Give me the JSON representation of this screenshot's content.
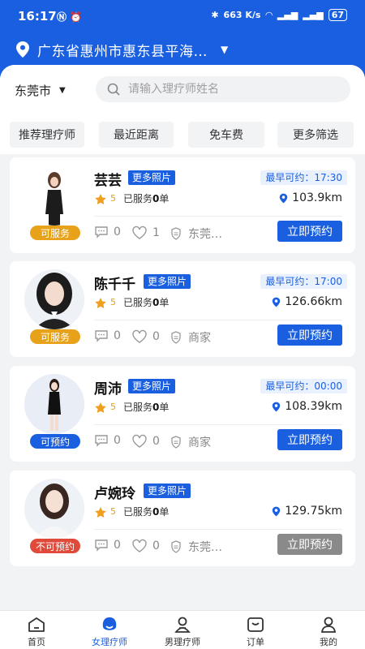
{
  "status_bar": {
    "time": "16:17",
    "net_speed": "663 K/s",
    "battery": "67"
  },
  "location": {
    "text": "广东省惠州市惠东县平海…"
  },
  "search": {
    "city": "东莞市",
    "placeholder": "请输入理疗师姓名"
  },
  "filters": [
    "推荐理疗师",
    "最近距离",
    "免车费",
    "更多筛选"
  ],
  "more_photos_label": "更多照片",
  "book_label": "立即预约",
  "served_prefix": "已服务",
  "served_suffix": "单",
  "therapists": [
    {
      "name": "芸芸",
      "status": "可服务",
      "status_color": "#e8a21a",
      "earliest": "最早可约：17:30",
      "rating": "5",
      "served_count": "0",
      "distance": "103.9km",
      "comments": "0",
      "likes": "1",
      "shop": "东莞…",
      "bookable": true
    },
    {
      "name": "陈千千",
      "status": "可服务",
      "status_color": "#e8a21a",
      "earliest": "最早可约：17:00",
      "rating": "5",
      "served_count": "0",
      "distance": "126.66km",
      "comments": "0",
      "likes": "0",
      "shop": "商家",
      "bookable": true
    },
    {
      "name": "周沛",
      "status": "可预约",
      "status_color": "#1a5fe0",
      "earliest": "最早可约：00:00",
      "rating": "5",
      "served_count": "0",
      "distance": "108.39km",
      "comments": "0",
      "likes": "0",
      "shop": "商家",
      "bookable": true
    },
    {
      "name": "卢婉玲",
      "status": "不可预约",
      "status_color": "#e04a3a",
      "earliest": "",
      "rating": "5",
      "served_count": "0",
      "distance": "129.75km",
      "comments": "0",
      "likes": "0",
      "shop": "东莞…",
      "bookable": false
    }
  ],
  "tabbar": [
    "首页",
    "女理疗师",
    "男理疗师",
    "订单",
    "我的"
  ],
  "colors": {
    "primary": "#1a5fe0",
    "background": "#f2f3f5"
  }
}
